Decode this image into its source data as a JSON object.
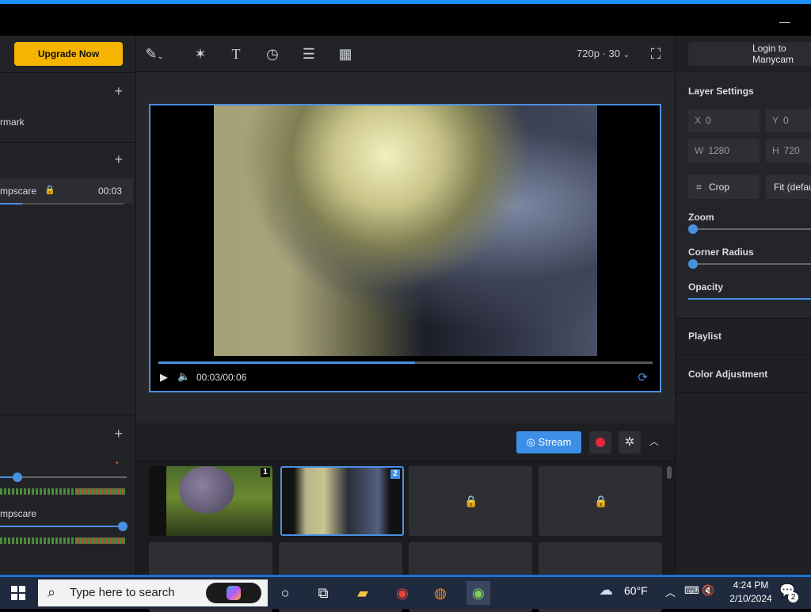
{
  "app": {
    "upgrade_label": "Upgrade Now",
    "login_label": "Login to Manycam",
    "minimize_glyph": "—"
  },
  "left_panel": {
    "section1_label": "rmark",
    "section2_item": {
      "label": "mpscare",
      "time": "00:03"
    },
    "audio_item_label": "mpscare"
  },
  "toolbar": {
    "tools": [
      "pen-icon",
      "magic-wand-icon",
      "text-icon",
      "timer-icon",
      "lower-third-icon",
      "transparency-icon"
    ],
    "resolution": "720p · 30",
    "fullscreen_icon": "fullscreen-icon"
  },
  "player": {
    "time": "00:03/00:06",
    "progress": 0.52
  },
  "stream_bar": {
    "stream_label": "Stream"
  },
  "scenes": [
    {
      "number": "1",
      "locked": false,
      "active": false
    },
    {
      "number": "2",
      "locked": false,
      "active": true
    },
    {
      "number": "",
      "locked": true,
      "active": false
    },
    {
      "number": "",
      "locked": true,
      "active": false
    }
  ],
  "layer_settings": {
    "title": "Layer Settings",
    "x_label": "X",
    "x_value": "0",
    "y_label": "Y",
    "y_value": "0",
    "w_label": "W",
    "w_value": "1280",
    "h_label": "H",
    "h_value": "720",
    "crop_label": "Crop",
    "fit_label": "Fit (default)",
    "zoom_label": "Zoom",
    "corner_radius_label": "Corner Radius",
    "opacity_label": "Opacity"
  },
  "right_sections": {
    "playlist": "Playlist",
    "color_adjustment": "Color Adjustment"
  },
  "taskbar": {
    "search_placeholder": "Type here to search",
    "weather": "60°F",
    "time": "4:24 PM",
    "date": "2/10/2024",
    "notification_count": "2"
  },
  "colors": {
    "accent": "#4a90e2",
    "upgrade": "#f5b400",
    "record": "#e8273a"
  }
}
